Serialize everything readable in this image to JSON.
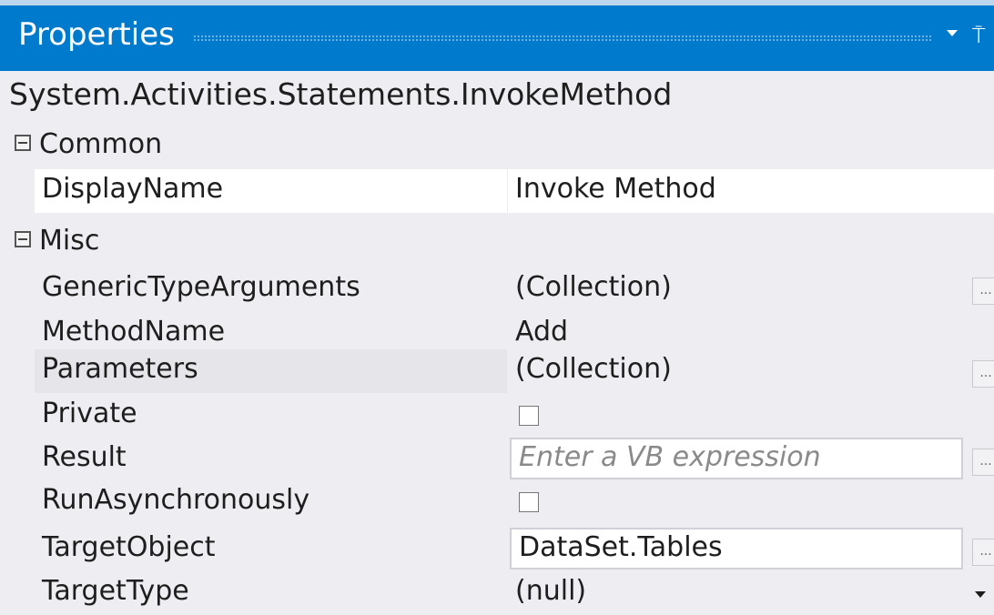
{
  "panel": {
    "title": "Properties",
    "pin_glyph": "⍑"
  },
  "type_name": "System.Activities.Statements.InvokeMethod",
  "categories": [
    {
      "label": "Common",
      "properties": [
        {
          "name": "DisplayName",
          "value": "Invoke Method"
        }
      ]
    },
    {
      "label": "Misc",
      "properties": [
        {
          "name": "GenericTypeArguments",
          "value": "(Collection)",
          "button": "..."
        },
        {
          "name": "MethodName",
          "value": "Add"
        },
        {
          "name": "Parameters",
          "value": "(Collection)",
          "button": "..."
        },
        {
          "name": "Private",
          "value": "",
          "editor": "checkbox",
          "checked": false
        },
        {
          "name": "Result",
          "value": "",
          "placeholder": "Enter a VB expression",
          "button": "..."
        },
        {
          "name": "RunAsynchronously",
          "value": "",
          "editor": "checkbox",
          "checked": false
        },
        {
          "name": "TargetObject",
          "value": "DataSet.Tables",
          "button": "..."
        },
        {
          "name": "TargetType",
          "value": "(null)",
          "editor": "dropdown"
        }
      ]
    }
  ],
  "colors": {
    "title_bar": "#007acc",
    "panel_bg": "#eeeef2",
    "row_highlight": "#ffffff",
    "selected_row": "#e6e6ea"
  }
}
